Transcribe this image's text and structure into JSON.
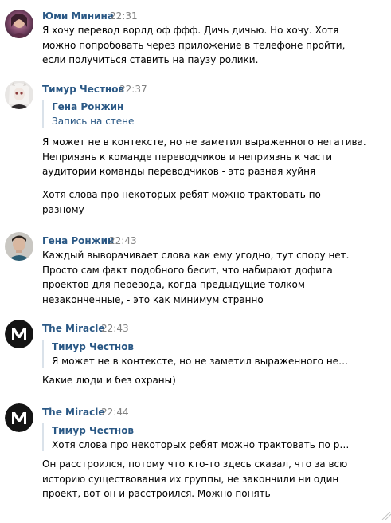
{
  "messages": [
    {
      "author": "Юми Минина",
      "time": "22:31",
      "avatar_icon": "user-photo-icon",
      "lines": [
        "Я хочу перевод ворлд оф ффф. Дичь дичью. Но хочу. Хотя",
        "можно попробовать через приложение в телефоне пройти,",
        "если получиться ставить на паузу ролики."
      ]
    },
    {
      "author": "Тимур Честнов",
      "time": "22:37",
      "avatar_icon": "user-photo-icon",
      "quote": {
        "author": "Гена Ронжин",
        "text": "Запись на стене"
      },
      "lines": [
        "Я может не в контексте, но не заметил выраженного негатива.",
        "Неприязнь к команде переводчиков и неприязнь к части",
        "аудитории команды переводчиков - это разная хуйня"
      ],
      "lines2": [
        "Хотя слова про некоторых ребят можно трактовать по",
        "разному"
      ]
    },
    {
      "author": "Гена Ронжин",
      "time": "22:43",
      "avatar_icon": "user-photo-icon",
      "lines": [
        "Каждый выворачивает слова как ему угодно, тут спору нет.",
        "Просто сам факт подобного бесит, что набирают дофига",
        "проектов для перевода, когда предыдущие толком",
        "незаконченные, - это как минимум странно"
      ]
    },
    {
      "author": "The Miracle",
      "time": "22:43",
      "avatar_icon": "miracle-logo-icon",
      "quote": {
        "author": "Тимур Честнов",
        "text": "Я может не в контексте, но не заметил выраженного негати..."
      },
      "lines": [
        "Какие люди и без охраны)"
      ]
    },
    {
      "author": "The Miracle",
      "time": "22:44",
      "avatar_icon": "miracle-logo-icon",
      "quote": {
        "author": "Тимур Честнов",
        "text": "Хотя слова про некоторых ребят можно трактовать по разн..."
      },
      "lines": [
        "Он расстроился, потому что кто-то здесь сказал, что за всю",
        "историю существования их группы, не закончили ни один",
        "проект, вот он и расстроился. Можно понять"
      ]
    }
  ],
  "colors": {
    "author": "#2a5885",
    "time": "#828282",
    "text": "#000000",
    "quote_border": "#dae2ea"
  }
}
